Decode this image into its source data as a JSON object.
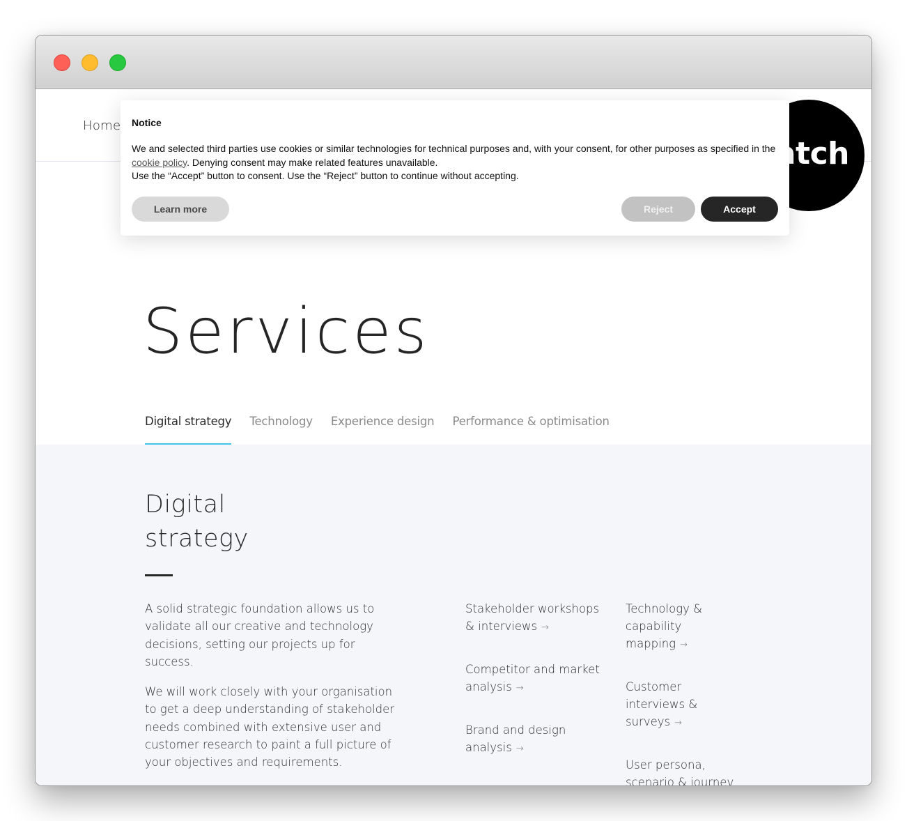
{
  "window": {
    "traffic_lights": [
      "close",
      "minimize",
      "maximize"
    ]
  },
  "header": {
    "nav_home": "Home",
    "logo_text": "atch"
  },
  "cookie_notice": {
    "title": "Notice",
    "body_part1": "We and selected third parties use cookies or similar technologies for technical purposes and, with your consent, for other purposes as specified in the ",
    "link_text": "cookie policy",
    "body_part2": ". Denying consent may make related features unavailable.",
    "body_line3": "Use the “Accept” button to consent. Use the “Reject” button to continue without accepting.",
    "learn_more_label": "Learn more",
    "reject_label": "Reject",
    "accept_label": "Accept"
  },
  "page": {
    "title": "Services",
    "tabs": [
      {
        "label": "Digital strategy",
        "active": true
      },
      {
        "label": "Technology",
        "active": false
      },
      {
        "label": "Experience design",
        "active": false
      },
      {
        "label": "Performance & optimisation",
        "active": false
      }
    ],
    "accent_color": "#3fc3e8"
  },
  "section": {
    "title_line1": "Digital",
    "title_line2": "strategy",
    "intro_paragraphs": [
      "A solid strategic foundation allows us to validate all our creative and technology decisions, setting our projects up for success.",
      "We will work closely with your organisation to get a deep understanding of stakeholder needs combined with extensive user and customer research to paint a full picture of your objectives and requirements."
    ],
    "services_col1": [
      {
        "label": "Stakeholder workshops & interviews",
        "icon": "arrow-right-icon"
      },
      {
        "label": "Competitor and market analysis",
        "icon": "arrow-right-icon"
      },
      {
        "label": "Brand and design analysis",
        "icon": "arrow-right-icon"
      }
    ],
    "services_col2": [
      {
        "label": "Technology & capability mapping",
        "icon": "arrow-right-icon"
      },
      {
        "label": "Customer interviews & surveys",
        "icon": "arrow-right-icon"
      },
      {
        "label": "User persona, scenario & journey",
        "icon": "arrow-right-icon"
      }
    ],
    "arrow_glyph": "→"
  }
}
